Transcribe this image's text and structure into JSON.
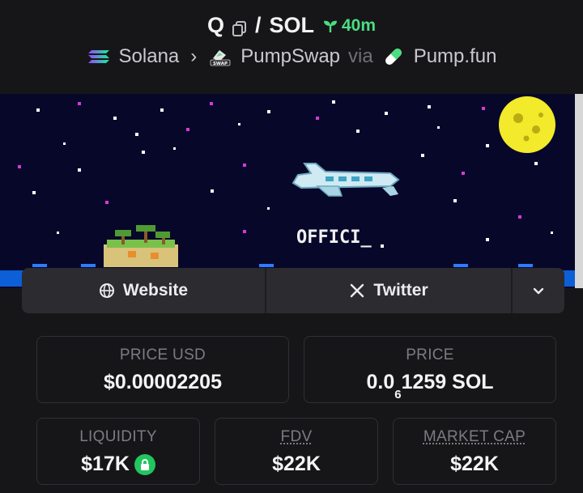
{
  "header": {
    "symbol": "Q",
    "pair_sep": "/",
    "quote": "SOL",
    "age": "40m",
    "chain": "Solana",
    "dex": "PumpSwap",
    "via": "via",
    "launchpad": "Pump.fun",
    "dex_badge_text": "SWAP"
  },
  "banner": {
    "text": "OFFICI_"
  },
  "links": {
    "website": "Website",
    "twitter": "Twitter"
  },
  "stats": {
    "price_usd_label": "PRICE USD",
    "price_usd_value": "$0.00002205",
    "price_label": "PRICE",
    "price_value_prefix": "0.0",
    "price_value_sub": "6",
    "price_value_suffix": "1259 SOL",
    "liquidity_label": "LIQUIDITY",
    "liquidity_value": "$17K",
    "fdv_label": "FDV",
    "fdv_value": "$22K",
    "mcap_label": "MARKET CAP",
    "mcap_value": "$22K"
  },
  "colors": {
    "background": "#161618",
    "accent_green": "#4ade80",
    "banner_sky": "#07072a",
    "moon": "#f2ea2a"
  }
}
